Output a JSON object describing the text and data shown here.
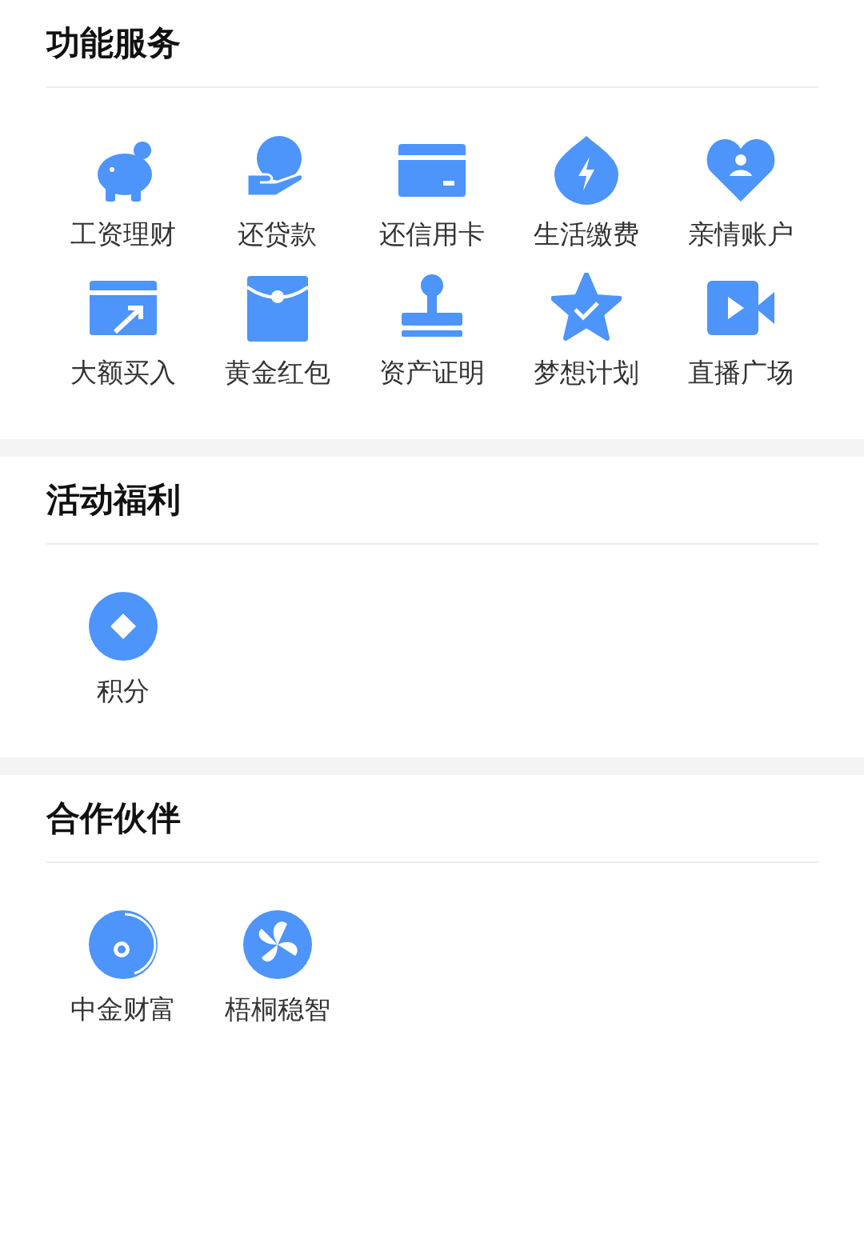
{
  "sections": [
    {
      "title": "功能服务",
      "items": [
        {
          "label": "工资理财"
        },
        {
          "label": "还贷款"
        },
        {
          "label": "还信用卡"
        },
        {
          "label": "生活缴费"
        },
        {
          "label": "亲情账户"
        },
        {
          "label": "大额买入"
        },
        {
          "label": "黄金红包"
        },
        {
          "label": "资产证明"
        },
        {
          "label": "梦想计划"
        },
        {
          "label": "直播广场"
        }
      ]
    },
    {
      "title": "活动福利",
      "items": [
        {
          "label": "积分"
        }
      ]
    },
    {
      "title": "合作伙伴",
      "items": [
        {
          "label": "中金财富"
        },
        {
          "label": "梧桐稳智"
        }
      ]
    }
  ]
}
